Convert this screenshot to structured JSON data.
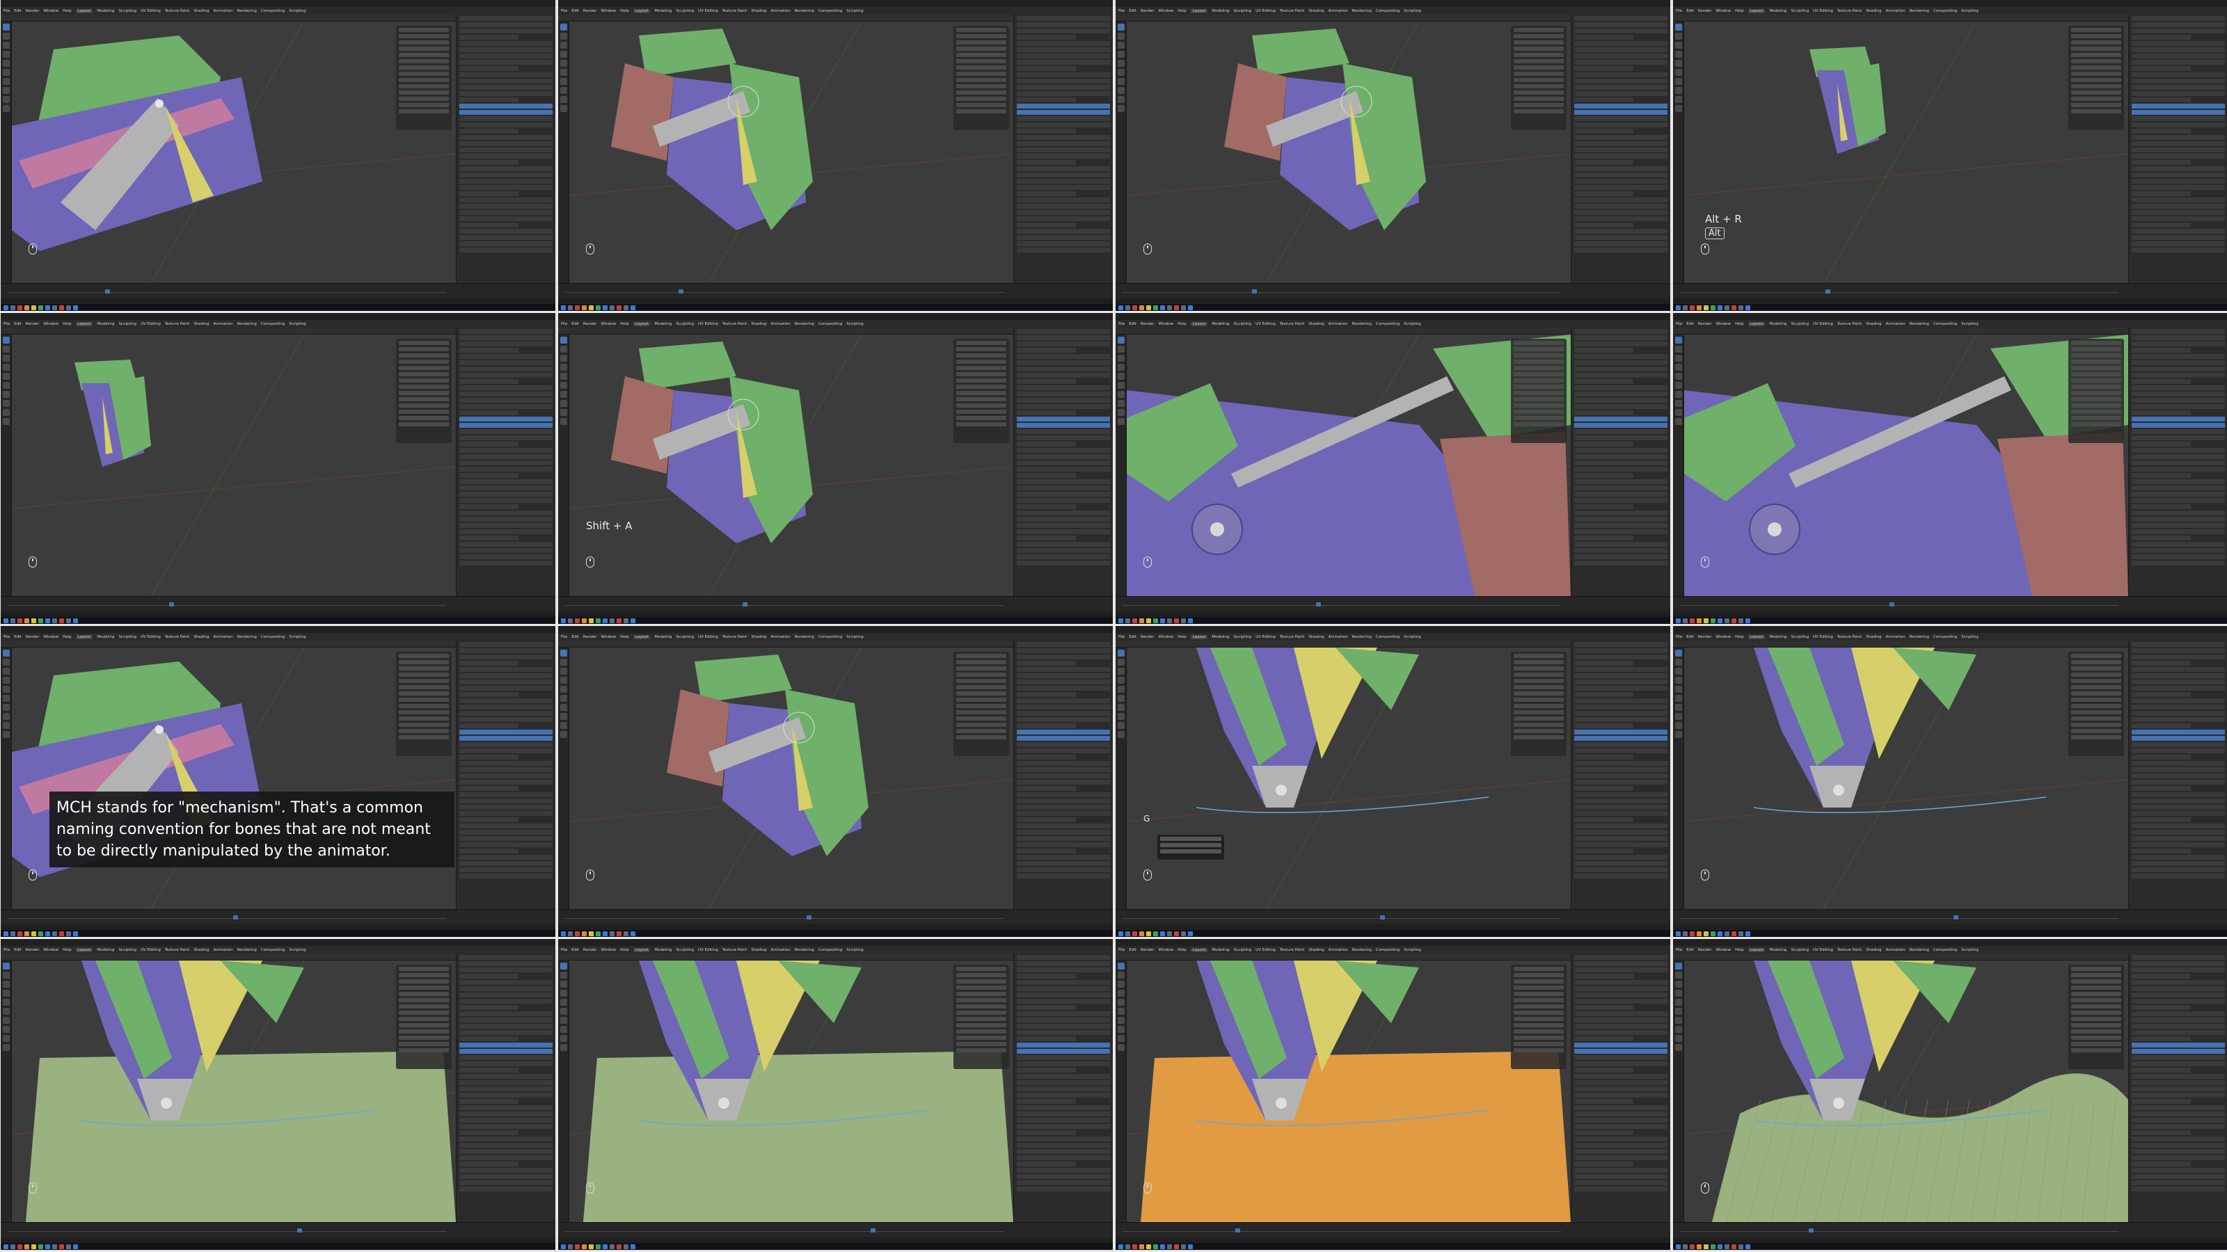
{
  "colors": {
    "viewport_bg": "#3c3c3c",
    "purple_mesh": "#6f66b8",
    "green_mesh": "#6fb06a",
    "red_mesh": "#a26b66",
    "grey_bone": "#b3b3b3",
    "yellow_bone": "#d7cf6a",
    "pink_piston": "#c07aa2",
    "ground_green": "#9ab27f",
    "ground_orange": "#e19b42",
    "accent_blue": "#4772b3"
  },
  "menu": [
    "File",
    "Edit",
    "Render",
    "Window",
    "Help",
    "Layout",
    "Modeling",
    "Sculpting",
    "UV Editing",
    "Texture Paint",
    "Shading",
    "Animation",
    "Rendering",
    "Compositing",
    "Scripting"
  ],
  "overlays": {
    "alt_r_label": "Alt + R",
    "alt_key": "Alt",
    "shift_a_label": "Shift + A",
    "g_key": "G",
    "subtitle": "MCH stands for \"mechanism\". That's a common naming convention for bones that are not meant to be directly manipulated by the animator."
  },
  "frames": [
    {
      "scene": "closeup-left",
      "ground": "none"
    },
    {
      "scene": "mid",
      "ground": "none"
    },
    {
      "scene": "mid-right",
      "ground": "none"
    },
    {
      "scene": "small",
      "ground": "none",
      "hint": "alt"
    },
    {
      "scene": "small-center",
      "ground": "none"
    },
    {
      "scene": "mid",
      "ground": "none",
      "hint": "shift"
    },
    {
      "scene": "closeup-right",
      "ground": "none"
    },
    {
      "scene": "closeup-right",
      "ground": "none"
    },
    {
      "scene": "closeup-left",
      "ground": "none",
      "hint": "subtitle"
    },
    {
      "scene": "mid-right",
      "ground": "none"
    },
    {
      "scene": "foot",
      "ground": "none",
      "hint": "g"
    },
    {
      "scene": "foot",
      "ground": "none"
    },
    {
      "scene": "foot-ground",
      "ground": "green"
    },
    {
      "scene": "foot-ground",
      "ground": "green"
    },
    {
      "scene": "foot-ground",
      "ground": "orange"
    },
    {
      "scene": "foot-ground",
      "ground": "terrain"
    }
  ]
}
